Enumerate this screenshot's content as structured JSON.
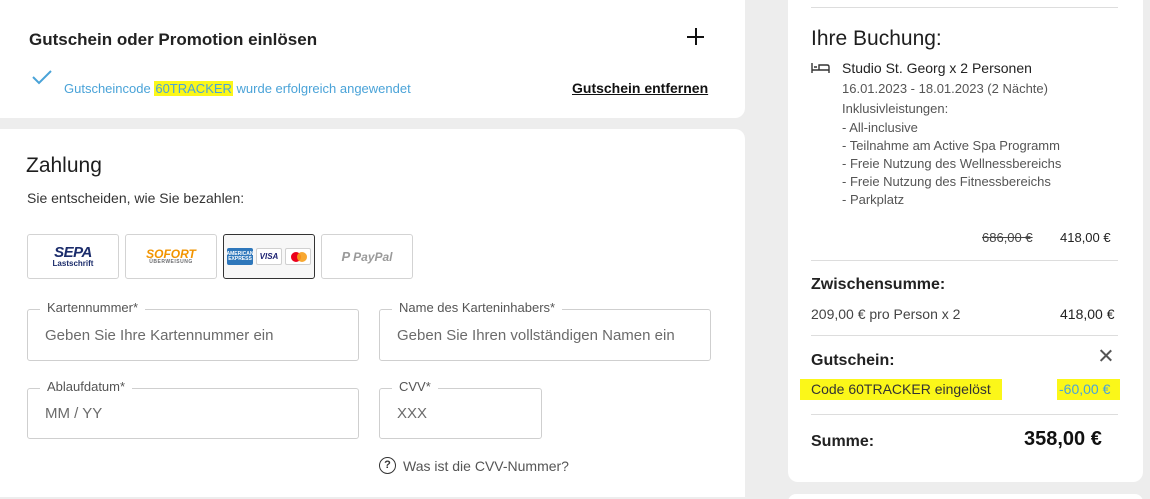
{
  "voucher": {
    "title": "Gutschein oder Promotion einlösen",
    "applied_prefix": "Gutscheincode ",
    "applied_code": "60TRACKER",
    "applied_suffix": " wurde erfolgreich angewendet",
    "remove_label": "Gutschein entfernen"
  },
  "payment": {
    "title": "Zahlung",
    "subtitle": "Sie entscheiden, wie Sie bezahlen:",
    "methods": {
      "sepa_main": "SEPA",
      "sepa_sub": "Lastschrift",
      "sofort_main": "SOFORT",
      "sofort_sub": "ÜBERWEISUNG",
      "amex": "AMERICAN EXPRESS",
      "visa": "VISA",
      "paypal": "PayPal"
    },
    "selected_method": "credit-card",
    "fields": {
      "card_number_label": "Kartennummer*",
      "card_number_placeholder": "Geben Sie Ihre Kartennummer ein",
      "holder_label": "Name des Karteninhabers*",
      "holder_placeholder": "Geben Sie Ihren vollständigen Namen ein",
      "expiry_label": "Ablaufdatum*",
      "expiry_placeholder": "MM / YY",
      "cvv_label": "CVV*",
      "cvv_placeholder": "XXX"
    },
    "cvv_help": "Was ist die CVV-Nummer?"
  },
  "summary": {
    "title": "Ihre Buchung:",
    "room": "Studio St. Georg x 2 Personen",
    "dates": "16.01.2023 - 18.01.2023 (2 Nächte)",
    "inclusions_label": "Inklusivleistungen:",
    "inclusions": [
      "- All-inclusive",
      "- Teilnahme am Active Spa Programm",
      "- Freie Nutzung des Wellnessbereichs",
      "- Freie Nutzung des Fitnessbereichs",
      "- Parkplatz"
    ],
    "old_price": "686,00 €",
    "new_price": "418,00 €",
    "subtotal_label": "Zwischensumme:",
    "subtotal_detail": "209,00 € pro Person x 2",
    "subtotal_amount": "418,00 €",
    "voucher_label": "Gutschein:",
    "voucher_code_text": "Code 60TRACKER eingelöst",
    "voucher_amount": "-60,00 €",
    "total_label": "Summe:",
    "total_amount": "358,00 €"
  },
  "colors": {
    "highlight": "#fbf719",
    "accent_blue": "#4aa3d8",
    "sofort_orange": "#f29400",
    "sepa_navy": "#1b2c6b"
  }
}
